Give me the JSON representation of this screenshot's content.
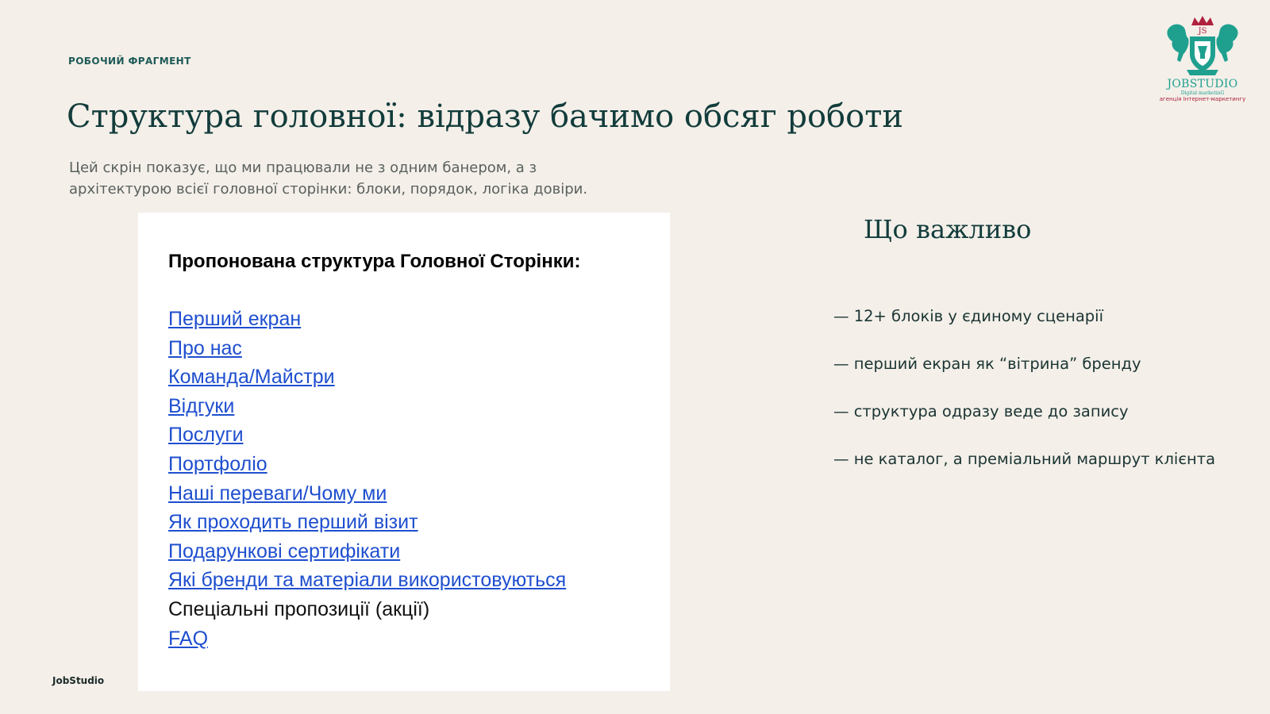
{
  "header": {
    "kicker": "РОБОЧИЙ ФРАГМЕНТ",
    "title": "Структура головної: відразу бачимо обсяг роботи",
    "subtitle": "Цей скрін показує, що ми працювали не з одним банером, а з архітектурою всієї головної сторінки: блоки, порядок, логіка довіри."
  },
  "logo": {
    "monogram": "JS",
    "name": "JOBSTUDIO",
    "tagline1": "Digital marketinG",
    "tagline2": "агенція Інтернет-маркетингу",
    "colors": {
      "primary": "#1fa08f",
      "accent": "#b0213d"
    }
  },
  "screenshot": {
    "heading": "Пропонована структура Головної Сторінки:",
    "items": [
      {
        "label": "Перший екран",
        "link": true
      },
      {
        "label": "Про нас",
        "link": true
      },
      {
        "label": "Команда/Майстри",
        "link": true
      },
      {
        "label": "Відгуки",
        "link": true
      },
      {
        "label": "Послуги",
        "link": true
      },
      {
        "label": "Портфоліо",
        "link": true
      },
      {
        "label": "Наші переваги/Чому ми",
        "link": true
      },
      {
        "label": "Як проходить перший візит",
        "link": true
      },
      {
        "label": "Подарункові сертифікати",
        "link": true
      },
      {
        "label": "Які бренди та матеріали використовуються",
        "link": true
      },
      {
        "label": "Спеціальні пропозиції (акції)",
        "link": false
      },
      {
        "label": "FAQ",
        "link": true
      }
    ],
    "link_color": "#1f4fcf"
  },
  "side": {
    "heading": "Що важливо",
    "points": [
      "— 12+ блоків у єдиному сценарії",
      "— перший екран як “вітрина” бренду",
      "— структура одразу веде до запису",
      "— не каталог, а преміальний маршрут клієнта"
    ]
  },
  "footer": {
    "brand": "JobStudio"
  },
  "colors": {
    "background": "#f4efe9",
    "title": "#123c3b",
    "kicker": "#1d5a57"
  }
}
